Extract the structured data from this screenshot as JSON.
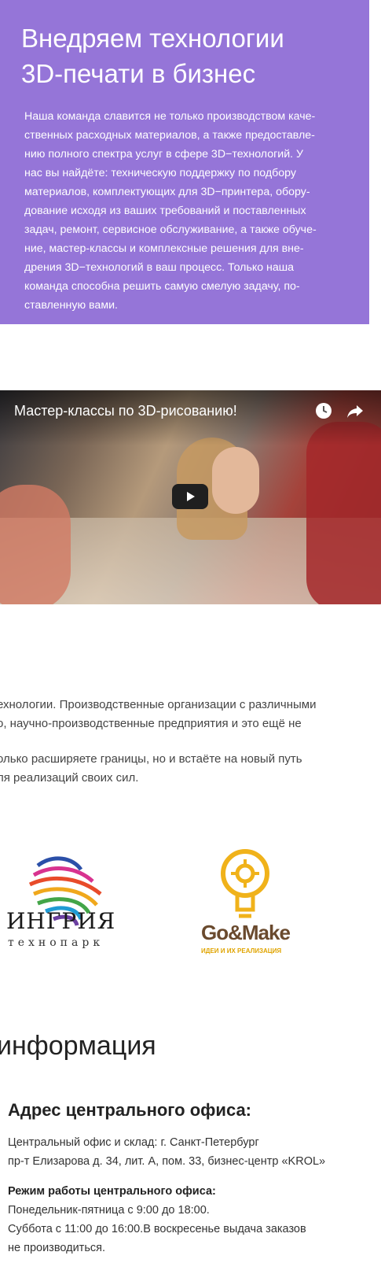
{
  "hero": {
    "title_line1": "Внедряем технологии",
    "title_line2": "3D-печати в бизнес",
    "paragraph_lines": [
      "Наша команда славится не только производством каче-",
      "ственных расходных материалов, а также предоставле-",
      "нию полного спектра услуг в сфере 3D−технологий. У",
      "нас вы найдёте: техническую поддержку по подбору",
      "материалов, комплектующих для 3D−принтера, обору-",
      "дование исходя из ваших требований и поставленных",
      "задач, ремонт, сервисное обслуживание, а также обуче-",
      "ние, мастер-классы и комплексные решения для вне-",
      "дрения 3D−технологий в ваш процесс. Только наша",
      "команда способна решить самую смелую задачу, по-",
      "ставленную вами."
    ],
    "background_color": "#9575d8"
  },
  "video": {
    "title": "Мастер-классы по 3D-рисованию!",
    "icons": [
      "clock-icon",
      "share-icon",
      "play-icon"
    ]
  },
  "info_text": {
    "lines": [
      "ехнологии. Производственные организации с различными",
      "о, научно-производственные предприятия и это ещё не",
      "олько расширяете границы, но и встаёте на новый путь",
      "ля реализаций своих сил."
    ]
  },
  "partners": {
    "ingria_name": "ИНГРИЯ",
    "ingria_sub": "технопарк",
    "gomake_name": "Go&Make",
    "gomake_sub": "ИДЕИ И ИХ РЕАЛИЗАЦИЯ"
  },
  "contacts": {
    "section_title": "информация",
    "office_title": "Адрес центрального офиса:",
    "office_lines": [
      "Центральный офис и склад: г. Санкт-Петербург",
      "пр-т Елизарова д. 34, лит. А, пом. 33, бизнес-центр «KROL»"
    ],
    "hours_title": "Режим работы центрального офиса:",
    "hours_lines": [
      "Понедельник-пятница с 9:00 до 18:00.",
      "Суббота с 11:00 до 16:00.В воскресенье выдача заказов",
      "не производиться."
    ]
  }
}
